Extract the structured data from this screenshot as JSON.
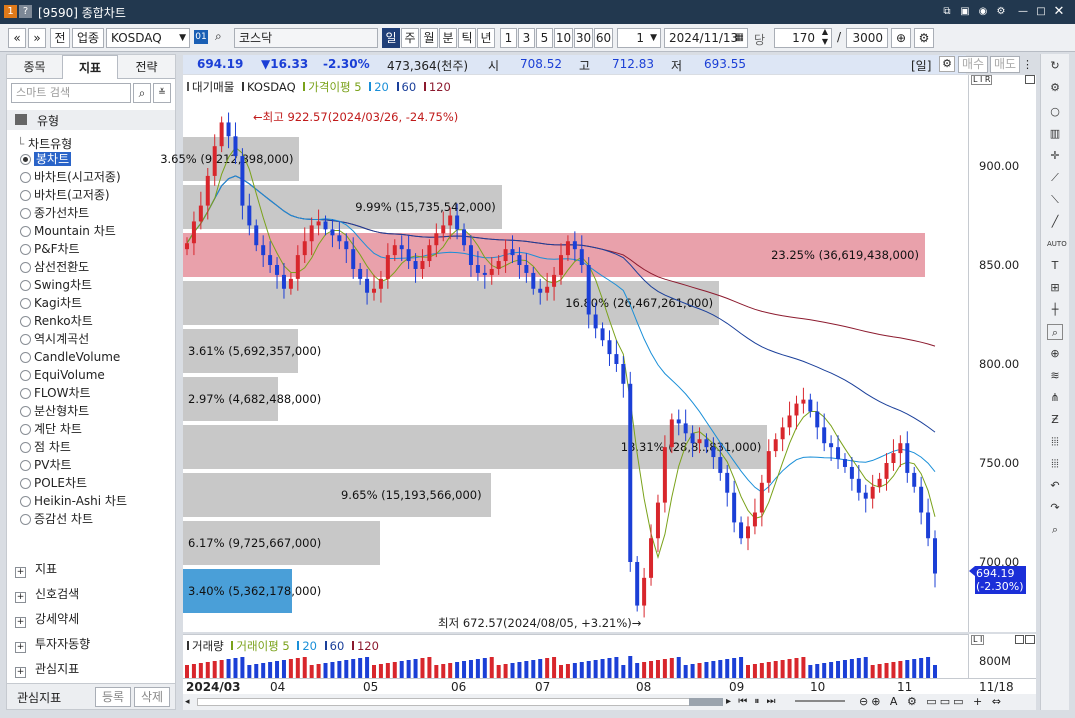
{
  "window": {
    "badge1": "1",
    "badge2": "?",
    "title": "[9590] 종합차트"
  },
  "toolbar": {
    "nav_prev": "«",
    "nav_down": "»",
    "prev_btn": "전",
    "category_btn": "업종",
    "symbol_value": "KOSDAQ",
    "code_badge": "01",
    "name_value": "코스닥",
    "periods": [
      "일",
      "주",
      "월",
      "분",
      "틱",
      "년"
    ],
    "minutes": [
      "1",
      "3",
      "5",
      "10",
      "30",
      "60"
    ],
    "interval_value": "1",
    "date_value": "2024/11/13",
    "date_label": "당",
    "count_value": "170",
    "slash": "/",
    "total_value": "3000"
  },
  "left_panel": {
    "tabs": [
      "종목",
      "지표",
      "전략"
    ],
    "search_placeholder": "스마트 검색",
    "type_header": "유형",
    "tree_root": "차트유형",
    "chart_types": [
      "봉차트",
      "바차트(시고저종)",
      "바차트(고저종)",
      "종가선차트",
      "Mountain 차트",
      "P&F차트",
      "삼선전환도",
      "Swing차트",
      "Kagi차트",
      "Renko차트",
      "역시계곡선",
      "CandleVolume",
      "EquiVolume",
      "FLOW차트",
      "분산형차트",
      "계단 차트",
      "점 차트",
      "PV차트",
      "POLE차트",
      "Heikin-Ashi 차트",
      "증감선 차트"
    ],
    "selected_type": "봉차트",
    "sections": [
      "지표",
      "신호검색",
      "강세약세",
      "투자자동향",
      "관심지표"
    ],
    "footer_label": "관심지표",
    "register_btn": "등록",
    "delete_btn": "삭제"
  },
  "info_bar": {
    "price": "694.19",
    "change": "▼16.33",
    "change_pct": "-2.30%",
    "volume": "473,364(천주)",
    "open_label": "시",
    "open": "708.52",
    "high_label": "고",
    "high": "712.83",
    "low_label": "저",
    "low": "693.55",
    "period_tag": "[일]",
    "buy_btn": "매수",
    "sell_btn": "매도"
  },
  "chart_legend": {
    "items": [
      "대기매물",
      "KOSDAQ",
      "가격이평 5",
      "20",
      "60",
      "120"
    ]
  },
  "colors": {
    "up": "#d8262c",
    "down": "#1b3fd6",
    "ma5": "#7aa21a",
    "ma20": "#1a8fd8",
    "ma60": "#1a3f9a",
    "ma120": "#8c1a2e",
    "volume_profile": "#c8c8c8",
    "volume_profile_highlight_red": "#e9a1ab",
    "volume_profile_highlight_blue": "#4a9fd8",
    "current_price_bg": "#1b2fd8"
  },
  "annotations": {
    "high": "←최고 922.57(2024/03/26, -24.75%)",
    "low": "최저 672.57(2024/08/05, +3.21%)→"
  },
  "volume_profile": [
    {
      "label": "3.65% (9,212,898,000)",
      "value": 3.65
    },
    {
      "label": "9.99% (15,735,542,000)",
      "value": 9.99
    },
    {
      "label": "23.25% (36,619,438,000)",
      "value": 23.25,
      "highlight": "red"
    },
    {
      "label": "16.80% (26,467,261,000)",
      "value": 16.8
    },
    {
      "label": "3.61% (5,692,357,000)",
      "value": 3.61
    },
    {
      "label": "2.97% (4,682,488,000)",
      "value": 2.97
    },
    {
      "label": "18.31% (28,8..,831,000)",
      "value": 18.31
    },
    {
      "label": "9.65% (15,193,566,000)",
      "value": 9.65
    },
    {
      "label": "6.17% (9,725,667,000)",
      "value": 6.17
    },
    {
      "label": "3.40% (5,362,178,000)",
      "value": 3.4,
      "highlight": "blue"
    }
  ],
  "price_axis": {
    "ticks": [
      "900.00",
      "850.00",
      "800.00",
      "750.00",
      "700.00"
    ],
    "current": "694.19",
    "current_pct": "(-2.30%)",
    "scale_label": "L I R"
  },
  "volume_panel": {
    "legend": [
      "거래량",
      "거래이평 5",
      "20",
      "60",
      "120"
    ],
    "axis_tick": "800M"
  },
  "x_axis": {
    "labels": [
      "2024/03",
      "04",
      "05",
      "06",
      "07",
      "08",
      "09",
      "10",
      "11"
    ],
    "end_label": "11/18"
  },
  "chart_data": {
    "type": "candlestick",
    "series": [
      {
        "name": "KOSDAQ",
        "values": [
          861,
          872,
          880,
          895,
          910,
          922,
          915,
          905,
          880,
          870,
          860,
          855,
          850,
          845,
          838,
          843,
          855,
          862,
          870,
          872,
          868,
          865,
          862,
          858,
          848,
          843,
          836,
          838,
          843,
          855,
          860,
          858,
          852,
          848,
          852,
          860,
          866,
          870,
          875,
          868,
          860,
          850,
          846,
          845,
          848,
          852,
          858,
          855,
          850,
          846,
          838,
          836,
          839,
          845,
          855,
          862,
          858,
          850,
          825,
          818,
          812,
          805,
          800,
          790,
          700,
          678,
          692,
          712,
          730,
          758,
          772,
          770,
          765,
          760,
          762,
          758,
          753,
          745,
          735,
          720,
          712,
          718,
          725,
          740,
          756,
          762,
          768,
          774,
          780,
          782,
          776,
          768,
          760,
          758,
          752,
          748,
          742,
          735,
          732,
          738,
          742,
          750,
          755,
          760,
          745,
          738,
          725,
          712,
          694.19
        ]
      }
    ],
    "ylim": [
      672.57,
      922.57
    ]
  }
}
